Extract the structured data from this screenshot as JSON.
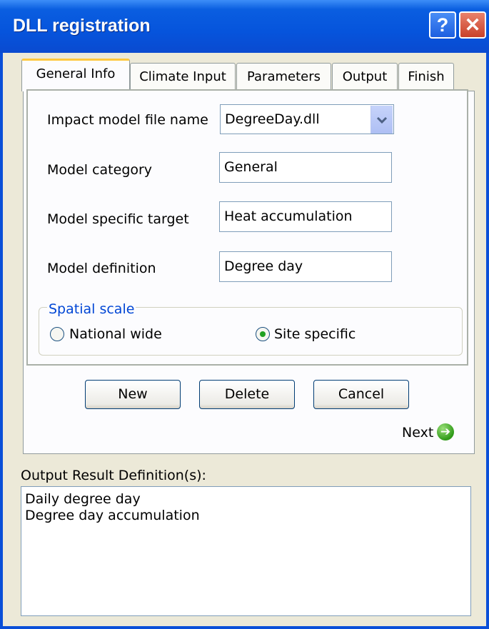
{
  "window": {
    "title": "DLL registration",
    "help_symbol": "?",
    "close_symbol": "✕"
  },
  "tabs": [
    {
      "label": "General Info"
    },
    {
      "label": "Climate Input"
    },
    {
      "label": "Parameters"
    },
    {
      "label": "Output"
    },
    {
      "label": "Finish"
    }
  ],
  "form": {
    "file_name_label": "Impact model file  name",
    "file_name_value": "DegreeDay.dll",
    "category_label": "Model category",
    "category_value": "General",
    "target_label": "Model specific target",
    "target_value": "Heat accumulation",
    "definition_label": "Model definition",
    "definition_value": "Degree day"
  },
  "spatial_scale": {
    "legend": "Spatial scale",
    "options": [
      "National wide",
      "Site specific"
    ],
    "selected": "Site specific"
  },
  "buttons": {
    "new": "New",
    "delete": "Delete",
    "cancel": "Cancel",
    "next": "Next"
  },
  "output": {
    "label": "Output Result Definition(s):",
    "items": [
      "Daily degree day",
      "Degree day accumulation"
    ]
  },
  "icons": {
    "dropdown": "chevron-down-icon",
    "next": "arrow-right-icon"
  },
  "colors": {
    "titlebar": "#0654dc",
    "active_tab_accent": "#ffc83c",
    "legend": "#0046d5",
    "radio_selected": "#21a121",
    "close": "#c9412a"
  }
}
